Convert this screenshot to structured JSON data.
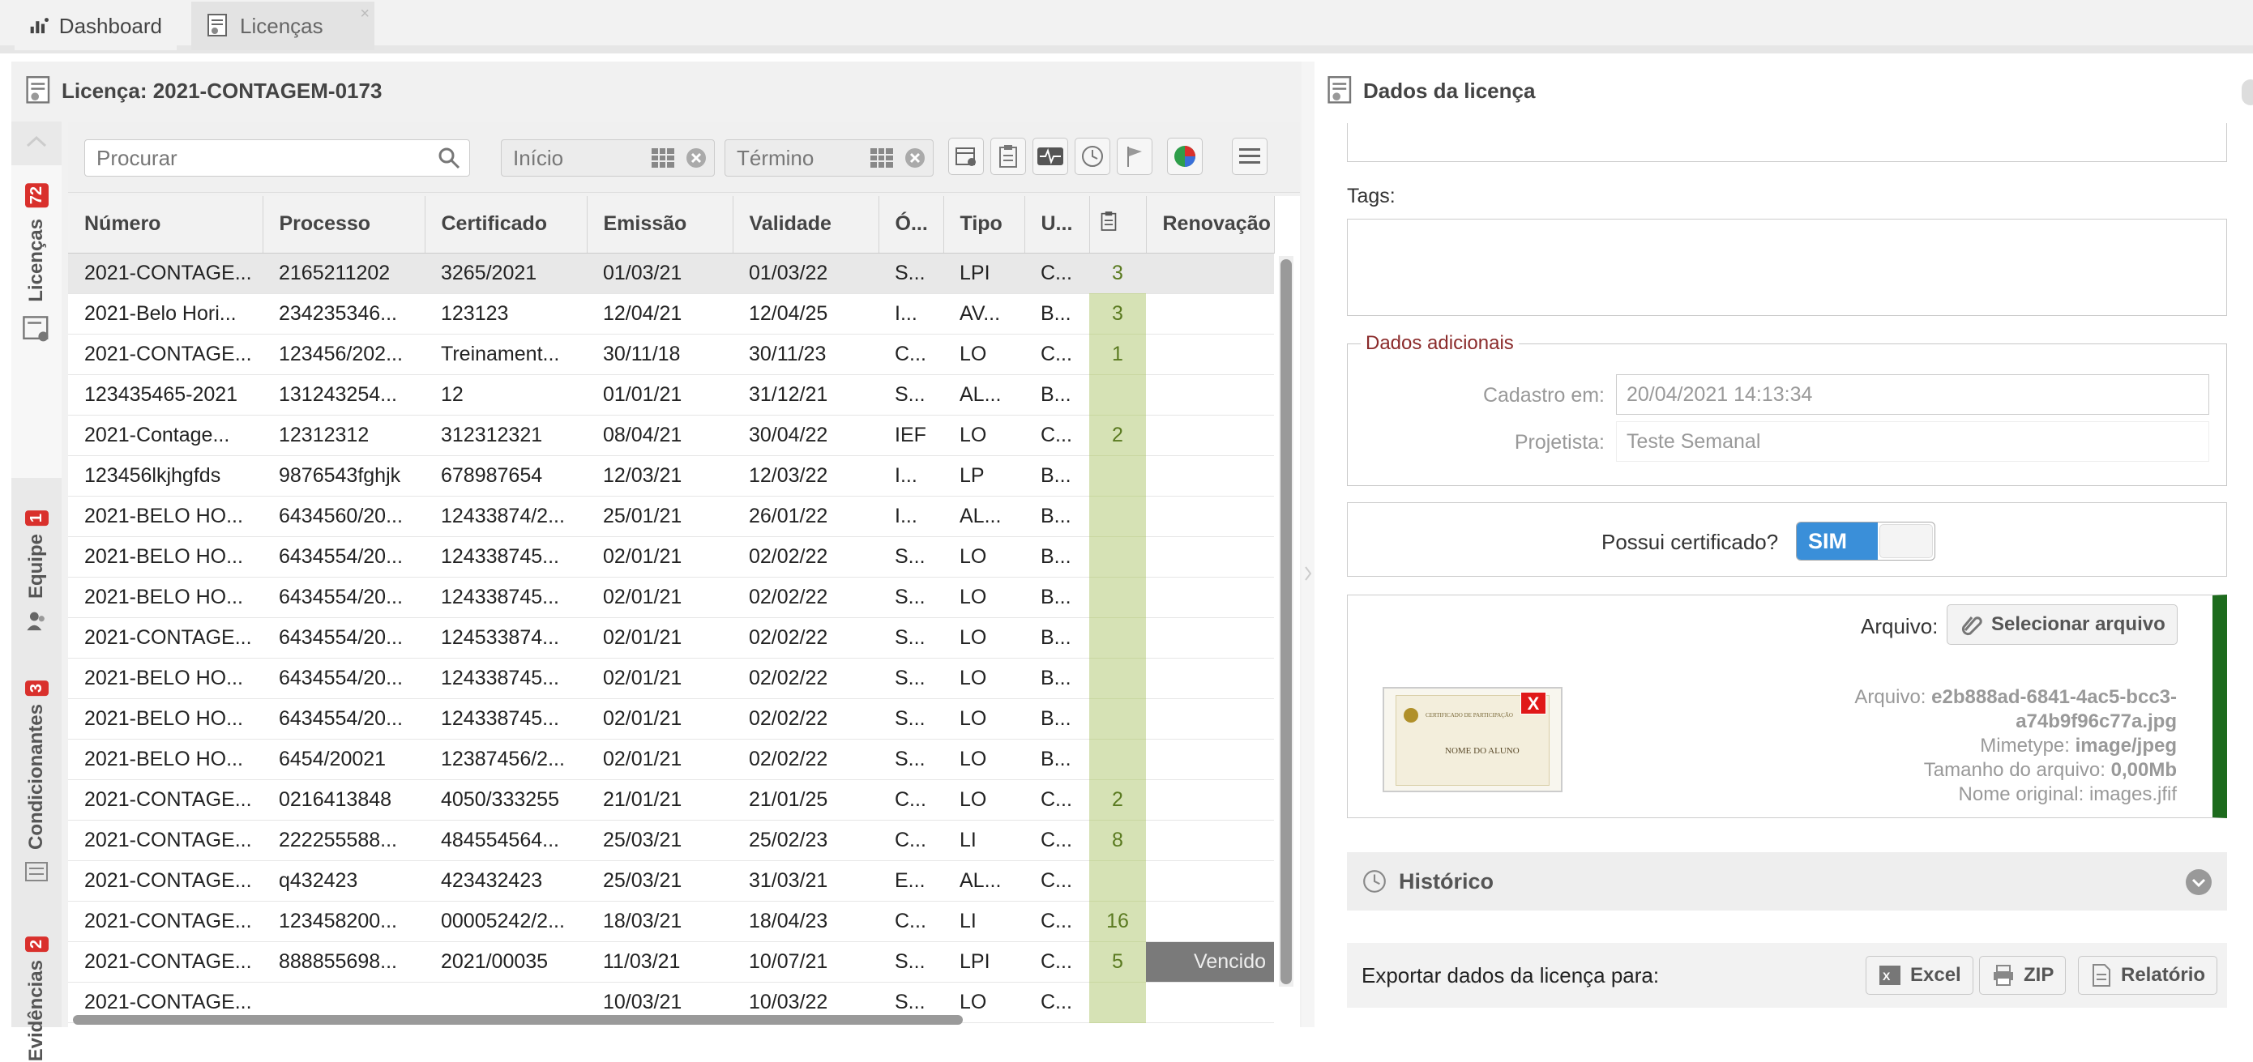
{
  "tabs": {
    "dashboard": "Dashboard",
    "licencas": "Licenças",
    "close": "×"
  },
  "left_panel": {
    "title": "Licença: 2021-CONTAGEM-0173"
  },
  "sidebar": {
    "items": [
      {
        "label": "Licenças",
        "badge": "72"
      },
      {
        "label": "Equipe",
        "badge": "1"
      },
      {
        "label": "Condicionantes",
        "badge": "3"
      },
      {
        "label": "Evidências",
        "badge": "2"
      }
    ]
  },
  "toolbar": {
    "search_placeholder": "Procurar",
    "start_placeholder": "Início",
    "end_placeholder": "Término"
  },
  "grid": {
    "columns": [
      "Número",
      "Processo",
      "Certificado",
      "Emissão",
      "Validade",
      "Ó...",
      "Tipo",
      "U...",
      "",
      "Renovação"
    ],
    "rows": [
      [
        "2021-CONTAGE...",
        "2165211202",
        "3265/2021",
        "01/03/21",
        "01/03/22",
        "S...",
        "LPI",
        "C...",
        "3",
        ""
      ],
      [
        "2021-Belo Hori...",
        "234235346...",
        "123123",
        "12/04/21",
        "12/04/25",
        "I...",
        "AV...",
        "B...",
        "3",
        ""
      ],
      [
        "2021-CONTAGE...",
        "123456/202...",
        "Treinament...",
        "30/11/18",
        "30/11/23",
        "C...",
        "LO",
        "C...",
        "1",
        ""
      ],
      [
        "123435465-2021",
        "131243254...",
        "12",
        "01/01/21",
        "31/12/21",
        "S...",
        "AL...",
        "B...",
        "",
        ""
      ],
      [
        "2021-Contage...",
        "12312312",
        "312312321",
        "08/04/21",
        "30/04/22",
        "IEF",
        "LO",
        "C...",
        "2",
        ""
      ],
      [
        "123456lkjhgfds",
        "9876543fghjk",
        "678987654",
        "12/03/21",
        "12/03/22",
        "I...",
        "LP",
        "B...",
        "",
        ""
      ],
      [
        "2021-BELO HO...",
        "6434560/20...",
        "12433874/2...",
        "25/01/21",
        "26/01/22",
        "I...",
        "AL...",
        "B...",
        "",
        ""
      ],
      [
        "2021-BELO HO...",
        "6434554/20...",
        "124338745...",
        "02/01/21",
        "02/02/22",
        "S...",
        "LO",
        "B...",
        "",
        ""
      ],
      [
        "2021-BELO HO...",
        "6434554/20...",
        "124338745...",
        "02/01/21",
        "02/02/22",
        "S...",
        "LO",
        "B...",
        "",
        ""
      ],
      [
        "2021-CONTAGE...",
        "6434554/20...",
        "124533874...",
        "02/01/21",
        "02/02/22",
        "S...",
        "LO",
        "B...",
        "",
        ""
      ],
      [
        "2021-BELO HO...",
        "6434554/20...",
        "124338745...",
        "02/01/21",
        "02/02/22",
        "S...",
        "LO",
        "B...",
        "",
        ""
      ],
      [
        "2021-BELO HO...",
        "6434554/20...",
        "124338745...",
        "02/01/21",
        "02/02/22",
        "S...",
        "LO",
        "B...",
        "",
        ""
      ],
      [
        "2021-BELO HO...",
        "6454/20021",
        "12387456/2...",
        "02/01/21",
        "02/02/22",
        "S...",
        "LO",
        "B...",
        "",
        ""
      ],
      [
        "2021-CONTAGE...",
        "0216413848",
        "4050/333255",
        "21/01/21",
        "21/01/25",
        "C...",
        "LO",
        "C...",
        "2",
        ""
      ],
      [
        "2021-CONTAGE...",
        "222255588...",
        "484554564...",
        "25/03/21",
        "25/02/23",
        "C...",
        "LI",
        "C...",
        "8",
        ""
      ],
      [
        "2021-CONTAGE...",
        "q432423",
        "423432423",
        "25/03/21",
        "31/03/21",
        "E...",
        "AL...",
        "C...",
        "",
        ""
      ],
      [
        "2021-CONTAGE...",
        "123458200...",
        "00005242/2...",
        "18/03/21",
        "18/04/23",
        "C...",
        "LI",
        "C...",
        "16",
        ""
      ],
      [
        "2021-CONTAGE...",
        "888855698...",
        "2021/00035",
        "11/03/21",
        "10/07/21",
        "S...",
        "LPI",
        "C...",
        "5",
        "Vencido"
      ],
      [
        "2021-CONTAGE...",
        "",
        "",
        "10/03/21",
        "10/03/22",
        "S...",
        "LO",
        "C...",
        "",
        ""
      ]
    ]
  },
  "right_panel": {
    "title": "Dados da licença",
    "tags_label": "Tags:",
    "dados_adicionais": {
      "legend": "Dados adicionais",
      "cadastro_label": "Cadastro em:",
      "cadastro_value": "20/04/2021 14:13:34",
      "projetista_label": "Projetista:",
      "projetista_value": "Teste Semanal"
    },
    "certificado": {
      "question": "Possui certificado?",
      "toggle": "SIM"
    },
    "arquivo": {
      "label": "Arquivo:",
      "select_button": "Selecionar arquivo",
      "info_arquivo_label": "Arquivo:",
      "info_arquivo_value_1": "e2b888ad-6841-4ac5-bcc3-",
      "info_arquivo_value_2": "a74b9f96c77a.jpg",
      "mimetype_label": "Mimetype:",
      "mimetype_value": "image/jpeg",
      "tamanho_label": "Tamanho do arquivo:",
      "tamanho_value": "0,00Mb",
      "nome_label": "Nome original:",
      "nome_value": "images.jfif",
      "thumb_title": "CERTIFICADO DE PARTICIPAÇÃO",
      "thumb_name": "NOME DO ALUNO",
      "remove": "X"
    },
    "historico": "Histórico",
    "export": {
      "label": "Exportar dados da licença para:",
      "excel": "Excel",
      "zip": "ZIP",
      "relatorio": "Relatório"
    }
  },
  "colors": {
    "accent": "#3a8fd9",
    "badge": "#d9302c",
    "count_bg": "#d6e2b5",
    "expired_bg": "#7a7a7a",
    "green_bar": "#1d6b1d"
  }
}
